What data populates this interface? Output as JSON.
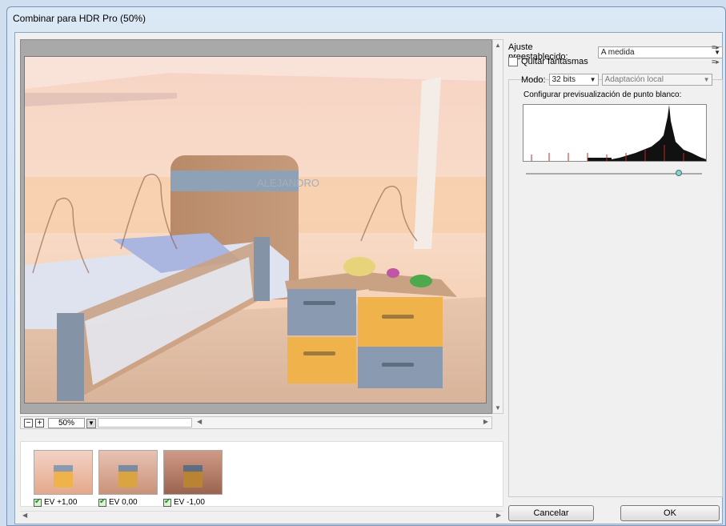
{
  "window": {
    "title": "Combinar para HDR Pro (50%)"
  },
  "preview": {
    "zoom_value": "50%",
    "image_text": "ALEJANDRO"
  },
  "thumbnails": [
    {
      "label": "EV +1,00"
    },
    {
      "label": "EV 0,00"
    },
    {
      "label": "EV -1,00"
    }
  ],
  "panel": {
    "preset_label": "Ajuste preestablecido:",
    "preset_value": "A medida",
    "ghost_label": "Quitar fantasmas",
    "mode_label": "Modo:",
    "mode_value": "32 bits",
    "method_value": "Adaptación local",
    "whitepoint_label": "Configurar previsualización de punto blanco:",
    "whitepoint_slider_value": 0.87
  },
  "buttons": {
    "cancel": "Cancelar",
    "ok": "OK"
  },
  "icons": {
    "zoom_out": "zoom-out-icon",
    "zoom_in": "zoom-in-icon",
    "menu": "panel-menu-icon"
  },
  "colors": {
    "title_bar": "#c8dbef",
    "preview_bg": "#a9a9a9",
    "accept_check": "#1f8f1f"
  }
}
